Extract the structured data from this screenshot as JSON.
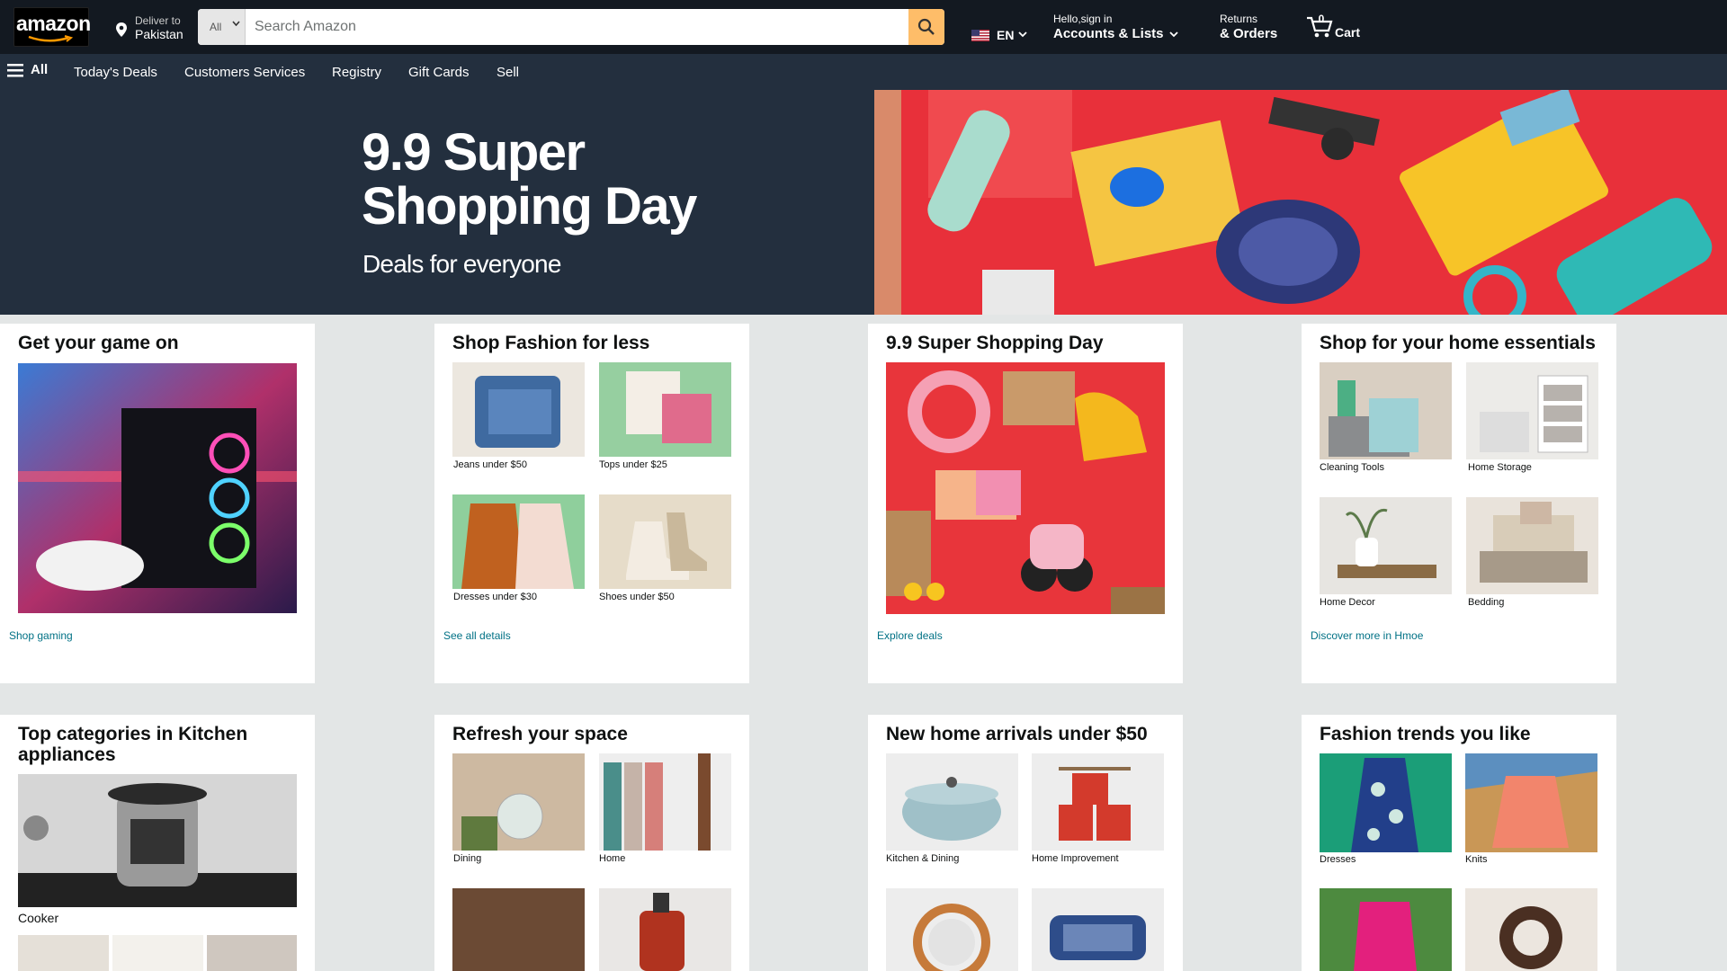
{
  "header": {
    "logo_text": "amazon",
    "deliver_line1": "Deliver to",
    "deliver_line2": "Pakistan",
    "search_category": "All",
    "search_placeholder": "Search Amazon",
    "language": "EN",
    "account_line1": "Hello,sign in",
    "account_line2": "Accounts & Lists",
    "orders_line1": "Returns",
    "orders_line2": "& Orders",
    "cart_count": "0",
    "cart_label": "Cart"
  },
  "nav": {
    "all_label": "All",
    "items": [
      "Today's Deals",
      "Customers Services",
      "Registry",
      "Gift Cards",
      "Sell"
    ]
  },
  "hero": {
    "title_line1": "9.9 Super",
    "title_line2": "Shopping Day",
    "subtitle": "Deals for everyone"
  },
  "cards": [
    {
      "title": "Get your game on",
      "link": "Shop gaming"
    },
    {
      "title": "Shop Fashion for less",
      "link": "See all details",
      "items": [
        "Jeans under $50",
        "Tops under $25",
        "Dresses under $30",
        "Shoes under $50"
      ]
    },
    {
      "title": "9.9 Super Shopping Day",
      "link": "Explore deals"
    },
    {
      "title": "Shop for your home essentials",
      "link": "Discover more in Hmoe",
      "items": [
        "Cleaning Tools",
        "Home Storage",
        "Home Decor",
        "Bedding"
      ]
    },
    {
      "title": "Top categories in Kitchen appliances",
      "main_item": "Cooker"
    },
    {
      "title": "Refresh your space",
      "items": [
        "Dining",
        "Home"
      ]
    },
    {
      "title": "New home arrivals under $50",
      "items": [
        "Kitchen & Dining",
        "Home Improvement"
      ]
    },
    {
      "title": "Fashion trends you like",
      "items": [
        "Dresses",
        "Knits"
      ]
    }
  ],
  "colors": {
    "header_bg": "#131921",
    "nav_bg": "#232f3e",
    "search_button": "#febd69",
    "link": "#007185",
    "hero_red": "#e62e36"
  }
}
